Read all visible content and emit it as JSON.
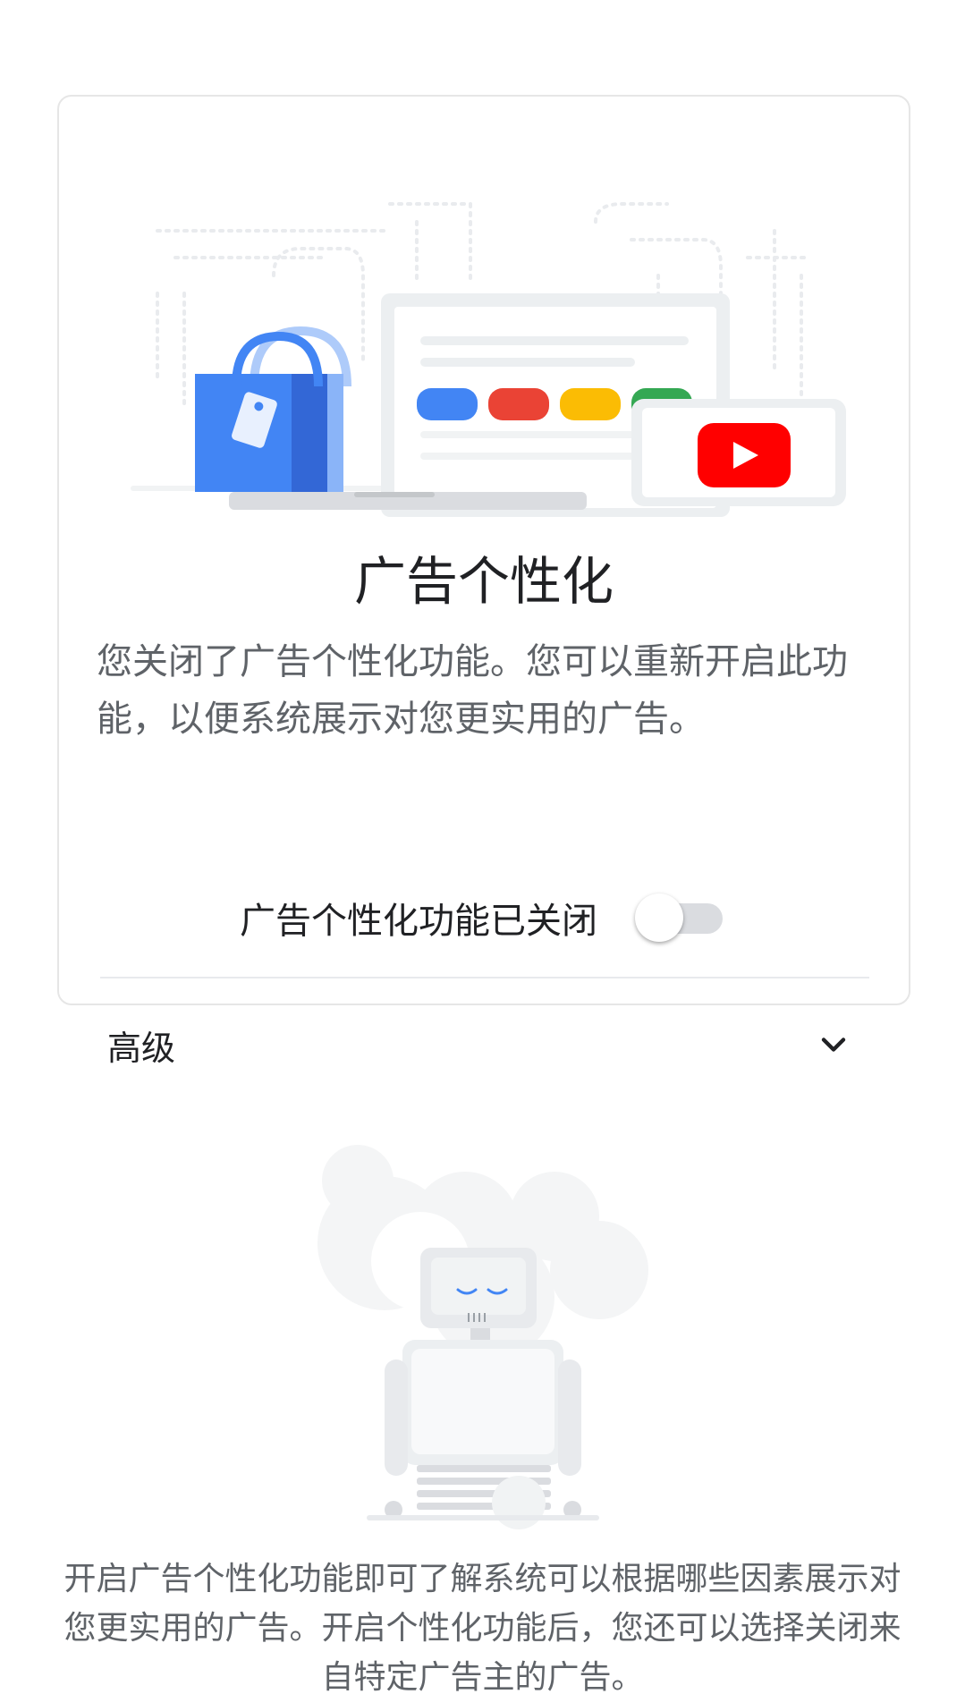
{
  "card": {
    "title": "广告个性化",
    "description": "您关闭了广告个性化功能。您可以重新开启此功能，以便系统展示对您更实用的广告。",
    "toggle_label": "广告个性化功能已关闭",
    "toggle_state": "off",
    "advanced_label": "高级"
  },
  "footer": {
    "text": "开启广告个性化功能即可了解系统可以根据哪些因素展示对您更实用的广告。开启个性化功能后，您还可以选择关闭来自特定广告主的广告。"
  },
  "colors": {
    "google_blue": "#4285f4",
    "google_red": "#ea4335",
    "google_yellow": "#fbbc04",
    "google_green": "#34a853",
    "youtube_red": "#ff0000"
  },
  "icons": [
    "shopping-bag-icon",
    "laptop-icon",
    "youtube-icon",
    "chevron-down-icon",
    "robot-illustration"
  ]
}
